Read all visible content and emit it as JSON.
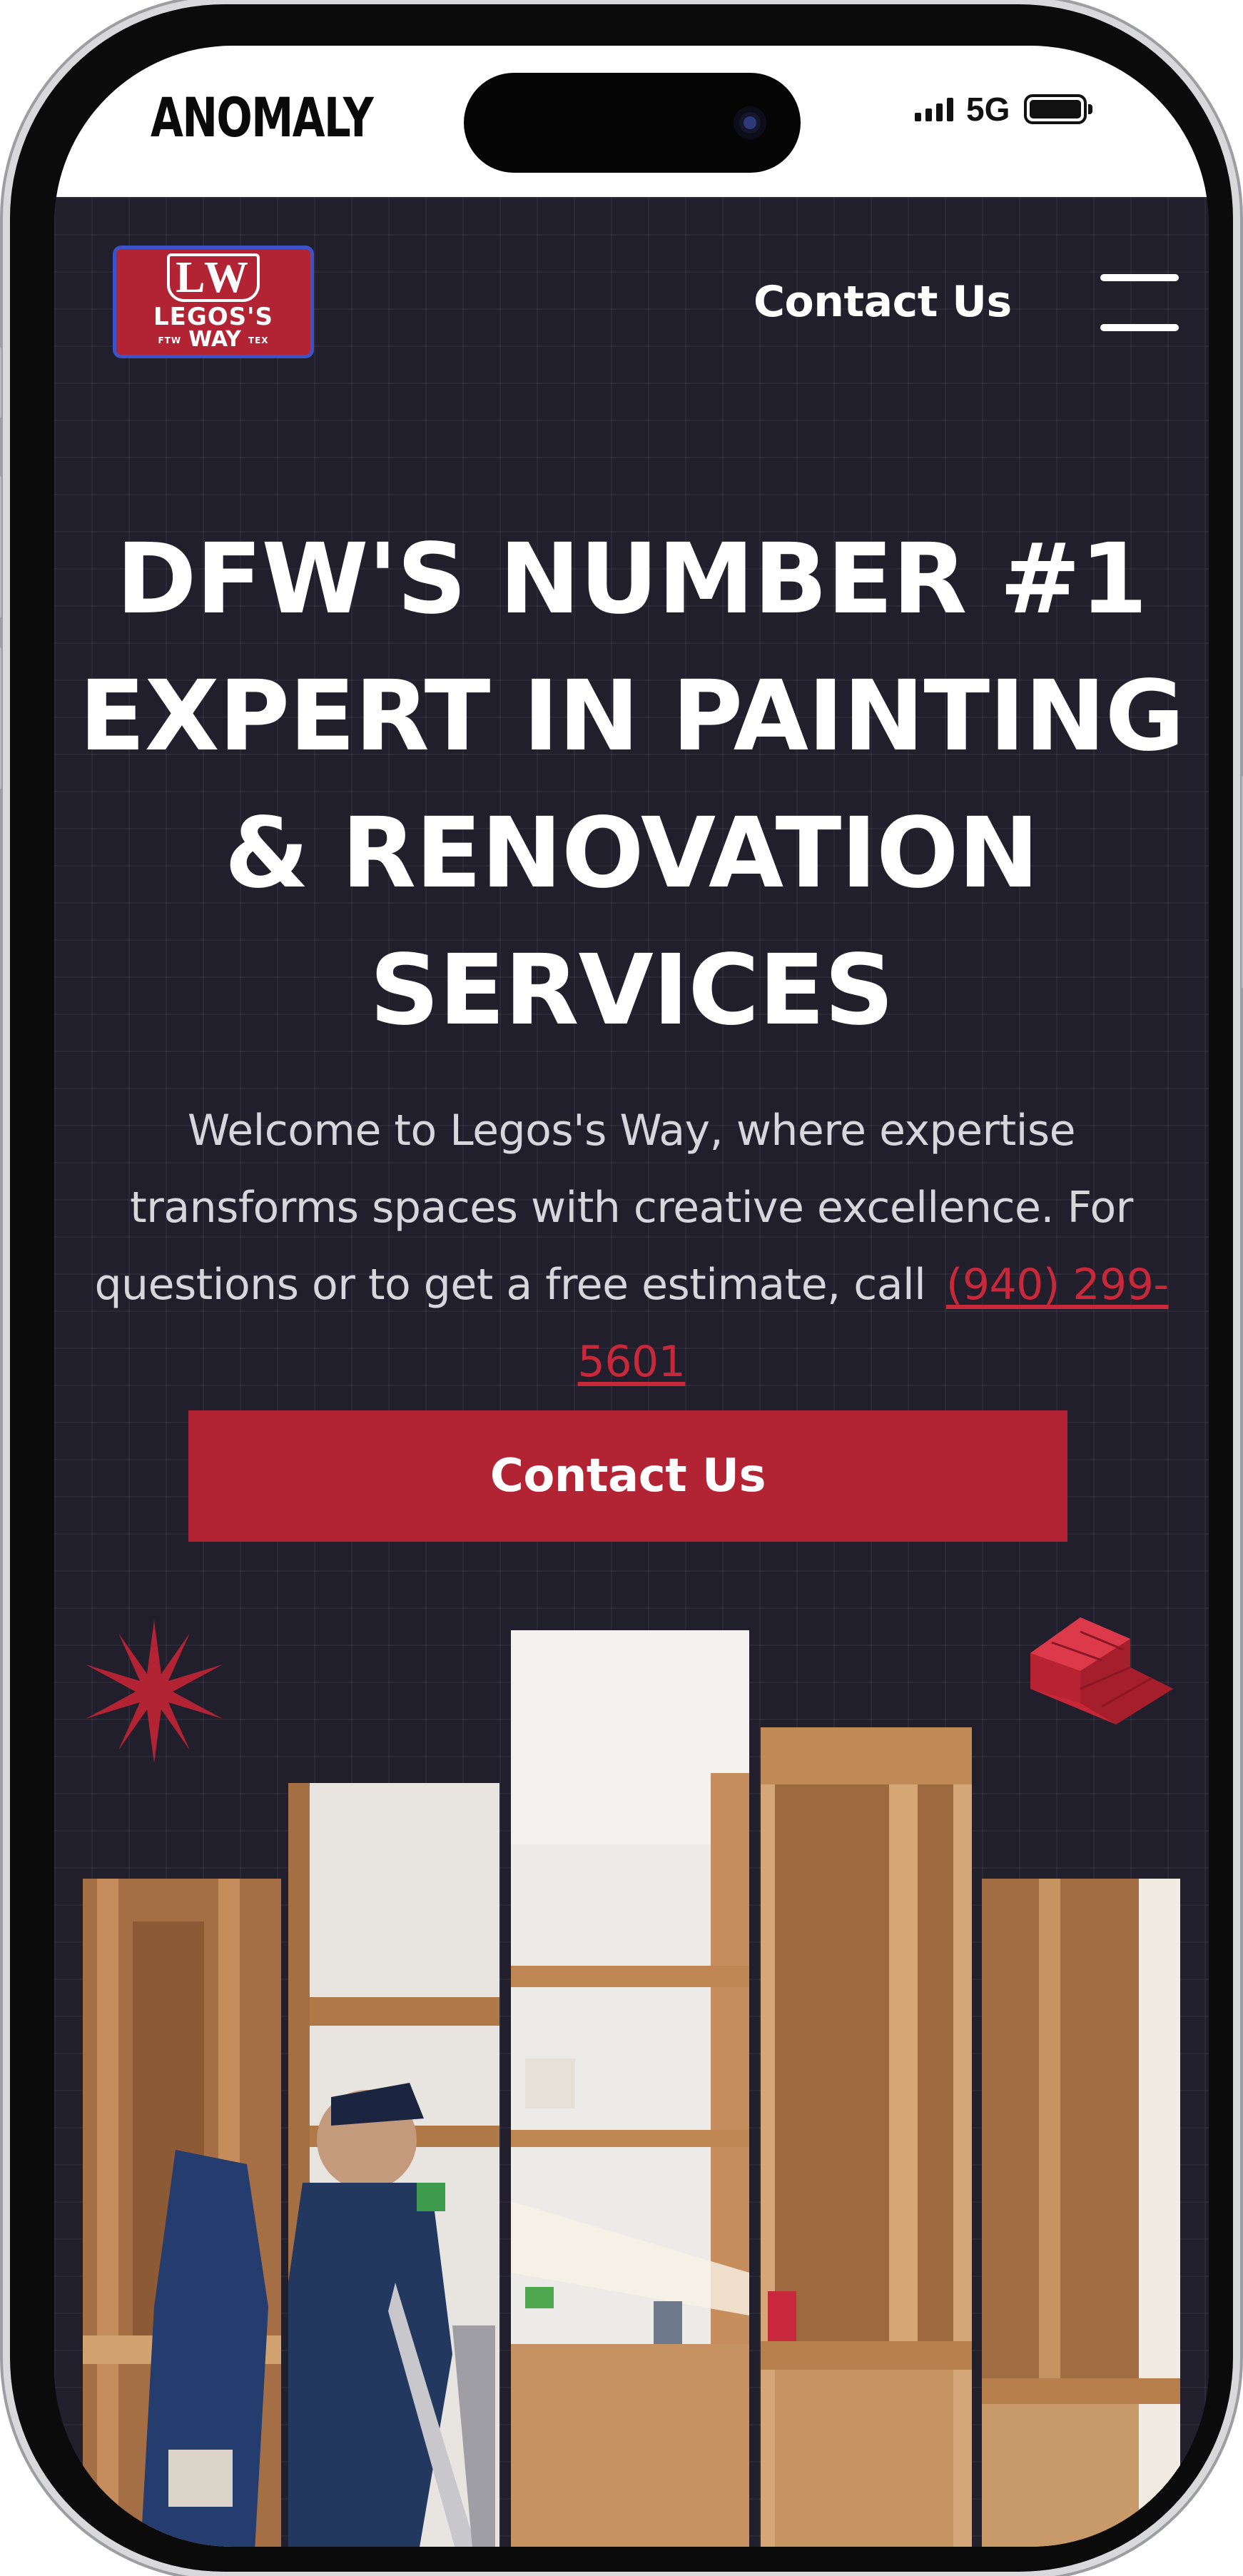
{
  "status_bar": {
    "carrier": "ANOMALY",
    "network": "5G"
  },
  "header": {
    "logo": {
      "mark": "LW",
      "name_line1": "LEGOS'S",
      "name_line2": "WAY",
      "tag_left": "FTW",
      "tag_right": "TEX"
    },
    "contact_link": "Contact Us",
    "menu_icon": "hamburger-icon"
  },
  "hero": {
    "headline": "DFW'S NUMBER #1 EXPERT IN PAINTING & RENOVATION SERVICES",
    "intro": "Welcome to Legos's Way, where expertise transforms spaces with creative excellence. For questions or to get a free estimate, call",
    "phone": "(940) 299-5601",
    "cta_label": "Contact Us"
  },
  "decorations": {
    "left_icon": "starburst-icon",
    "right_icon": "brick-icon"
  },
  "gallery": {
    "photo_strip_count": 5
  },
  "colors": {
    "background": "#211f2c",
    "accent": "#b22333",
    "text": "#ffffff",
    "muted_text": "#d7d6dc"
  }
}
